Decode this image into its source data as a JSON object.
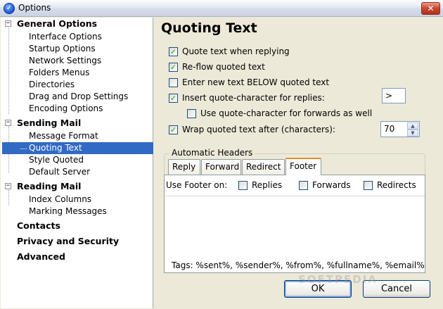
{
  "window": {
    "title": "Options",
    "close_glyph": "✕"
  },
  "tree": {
    "groups": [
      {
        "label": "General Options",
        "expander": "−",
        "children": [
          "Interface Options",
          "Startup Options",
          "Network Settings",
          "Folders Menus",
          "Directories",
          "Drag and Drop Settings",
          "Encoding Options"
        ]
      },
      {
        "label": "Sending Mail",
        "expander": "−",
        "children": [
          "Message Format",
          "Quoting Text",
          "Style Quoted",
          "Default Server"
        ]
      },
      {
        "label": "Reading Mail",
        "expander": "−",
        "children": [
          "Index Columns",
          "Marking Messages"
        ]
      }
    ],
    "leaf_groups": [
      "Contacts",
      "Privacy and Security",
      "Advanced"
    ],
    "selected": "Quoting Text"
  },
  "page": {
    "title": "Quoting Text",
    "options": [
      {
        "label": "Quote text when replying",
        "checked": true
      },
      {
        "label": "Re-flow quoted text",
        "checked": true
      },
      {
        "label": "Enter new text BELOW quoted text",
        "checked": false
      },
      {
        "label": "Insert quote-character for replies:",
        "checked": true
      },
      {
        "label": "Use quote-character for forwards as well",
        "checked": false
      },
      {
        "label": "Wrap quoted text after (characters):",
        "checked": true
      }
    ],
    "quote_char_value": ">",
    "wrap_value": "70",
    "check_glyph": "✓",
    "spin_up": "▲",
    "spin_down": "▼"
  },
  "headers": {
    "legend": "Automatic Headers",
    "tabs": [
      "Reply",
      "Forward",
      "Redirect",
      "Footer"
    ],
    "active_tab": "Footer",
    "use_footer_label": "Use Footer on:",
    "footer_options": [
      {
        "label": "Replies",
        "checked": false
      },
      {
        "label": "Forwards",
        "checked": false
      },
      {
        "label": "Redirects",
        "checked": false
      }
    ],
    "tags_text": "Tags: %sent%, %sender%, %from%, %fullname%, %email%"
  },
  "buttons": {
    "ok": "OK",
    "cancel": "Cancel"
  },
  "watermark": "SOFTPEDIA"
}
